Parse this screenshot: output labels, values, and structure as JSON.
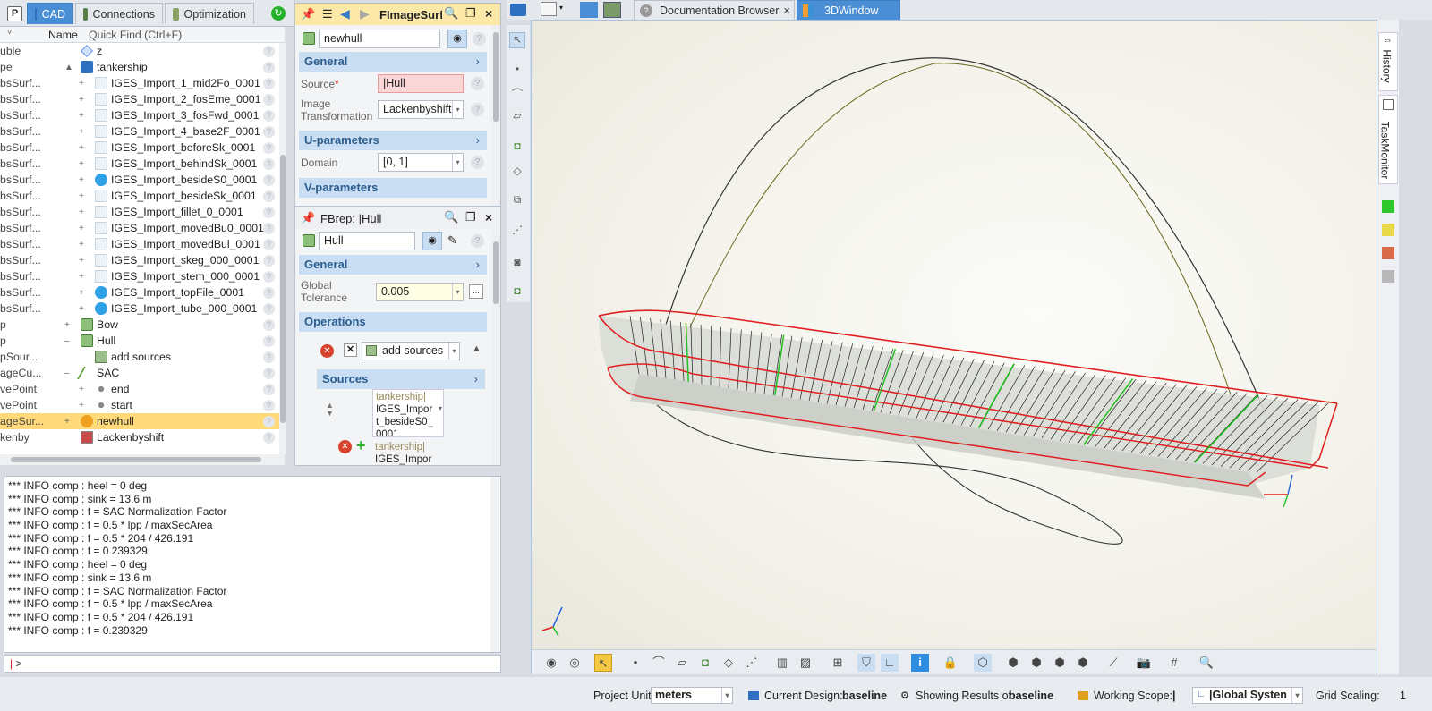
{
  "left_tabs": {
    "p_label": "P",
    "cad": "CAD",
    "connections": "Connections",
    "optimization": "Optimization"
  },
  "tree": {
    "col_name": "Name",
    "quick_find_placeholder": "Quick Find (Ctrl+F)",
    "rows": [
      {
        "type": "uble",
        "name": "z",
        "exp": "",
        "icon": "diamond"
      },
      {
        "type": "pe",
        "name": "tankership",
        "exp": "▲",
        "icon": "folder"
      },
      {
        "type": "bsSurf...",
        "name": "IGES_Import_1_mid2Fo_0001",
        "exp": "+",
        "icon": "surf"
      },
      {
        "type": "bsSurf...",
        "name": "IGES_Import_2_fosEme_0001",
        "exp": "+",
        "icon": "surf"
      },
      {
        "type": "bsSurf...",
        "name": "IGES_Import_3_fosFwd_0001",
        "exp": "+",
        "icon": "surf"
      },
      {
        "type": "bsSurf...",
        "name": "IGES_Import_4_base2F_0001",
        "exp": "+",
        "icon": "surf"
      },
      {
        "type": "bsSurf...",
        "name": "IGES_Import_beforeSk_0001",
        "exp": "+",
        "icon": "surf"
      },
      {
        "type": "bsSurf...",
        "name": "IGES_Import_behindSk_0001",
        "exp": "+",
        "icon": "surf"
      },
      {
        "type": "bsSurf...",
        "name": "IGES_Import_besideS0_0001",
        "exp": "+",
        "icon": "info"
      },
      {
        "type": "bsSurf...",
        "name": "IGES_Import_besideSk_0001",
        "exp": "+",
        "icon": "surf"
      },
      {
        "type": "bsSurf...",
        "name": "IGES_Import_fillet_0_0001",
        "exp": "+",
        "icon": "surf"
      },
      {
        "type": "bsSurf...",
        "name": "IGES_Import_movedBu0_0001",
        "exp": "+",
        "icon": "surf"
      },
      {
        "type": "bsSurf...",
        "name": "IGES_Import_movedBul_0001",
        "exp": "+",
        "icon": "surf"
      },
      {
        "type": "bsSurf...",
        "name": "IGES_Import_skeg_000_0001",
        "exp": "+",
        "icon": "surf"
      },
      {
        "type": "bsSurf...",
        "name": "IGES_Import_stem_000_0001",
        "exp": "+",
        "icon": "surf"
      },
      {
        "type": "bsSurf...",
        "name": "IGES_Import_topFile_0001",
        "exp": "+",
        "icon": "info"
      },
      {
        "type": "bsSurf...",
        "name": "IGES_Import_tube_000_0001",
        "exp": "+",
        "icon": "info"
      },
      {
        "type": "p",
        "name": "Bow",
        "exp": "+",
        "icon": "brep"
      },
      {
        "type": "p",
        "name": "Hull",
        "exp": "–",
        "icon": "brep"
      },
      {
        "type": "pSour...",
        "name": "add sources",
        "exp": "",
        "icon": "srcs"
      },
      {
        "type": "ageCu...",
        "name": "SAC",
        "exp": "–",
        "icon": "curve"
      },
      {
        "type": "vePoint",
        "name": "end",
        "exp": "+",
        "icon": "dot"
      },
      {
        "type": "vePoint",
        "name": "start",
        "exp": "+",
        "icon": "dot"
      },
      {
        "type": "ageSur...",
        "name": "newhull",
        "exp": "+",
        "icon": "warn"
      },
      {
        "type": "kenby",
        "name": "Lackenbyshift",
        "exp": "",
        "icon": "lack"
      }
    ]
  },
  "panel1": {
    "title": "FImageSurf",
    "name_value": "newhull",
    "general": "General",
    "source_label": "Source",
    "source_required": "*",
    "source_value": "|Hull",
    "image_trans_label1": "Image",
    "image_trans_label2": "Transformation",
    "image_trans_value": "Lackenbyshift",
    "u_params": "U-parameters",
    "domain_label": "Domain",
    "domain_value": "[0, 1]",
    "v_params": "V-parameters"
  },
  "panel2": {
    "title": "FBrep: |Hull",
    "name_value": "Hull",
    "general": "General",
    "tol_label1": "Global",
    "tol_label2": "Tolerance",
    "tol_value": "0.005",
    "tol_btn": "...",
    "operations": "Operations",
    "add_sources": "add sources",
    "sources": "Sources",
    "src1_line1": "tankership|",
    "src1_line2": "IGES_Impor",
    "src1_line3": "t_besideS0_",
    "src1_line4": "0001",
    "src2_line1": "tankership|",
    "src2_line2": "IGES_Impor"
  },
  "console": {
    "lines": [
      "*** INFO comp : heel = 0 deg",
      "*** INFO comp : sink = 13.6 m",
      "*** INFO comp : f = SAC Normalization Factor",
      "*** INFO comp : f = 0.5 * lpp / maxSecArea",
      "*** INFO comp : f = 0.5 * 204 / 426.191",
      "*** INFO comp : f = 0.239329",
      "*** INFO comp : heel = 0 deg",
      "*** INFO comp : sink = 13.6 m",
      "*** INFO comp : f = SAC Normalization Factor",
      "*** INFO comp : f = 0.5 * lpp / maxSecArea",
      "*** INFO comp : f = 0.5 * 204 / 426.191",
      "*** INFO comp : f = 0.239329"
    ],
    "prompt": ">"
  },
  "right_tabs": {
    "doc": "Documentation Browser",
    "win3d": "3DWindow",
    "close": "×"
  },
  "side_tabs": {
    "history": "History",
    "taskmonitor": "TaskMonitor"
  },
  "status": {
    "project_units_label": "Project Units:",
    "project_units_value": "meters",
    "current_design_label": "Current Design:",
    "current_design_value": "baseline",
    "showing_label": "Showing Results of",
    "showing_value": "baseline",
    "working_scope_label": "Working Scope:",
    "working_scope_value": "|",
    "coord_value": "|Global Systen",
    "grid_label": "Grid Scaling:",
    "grid_value": "1"
  },
  "colors": {
    "accent": "#4a8fd6",
    "selected": "#ffd97a",
    "hull_red": "#e02020",
    "hull_green": "#20c020",
    "panel_title": "#fce9a8"
  }
}
